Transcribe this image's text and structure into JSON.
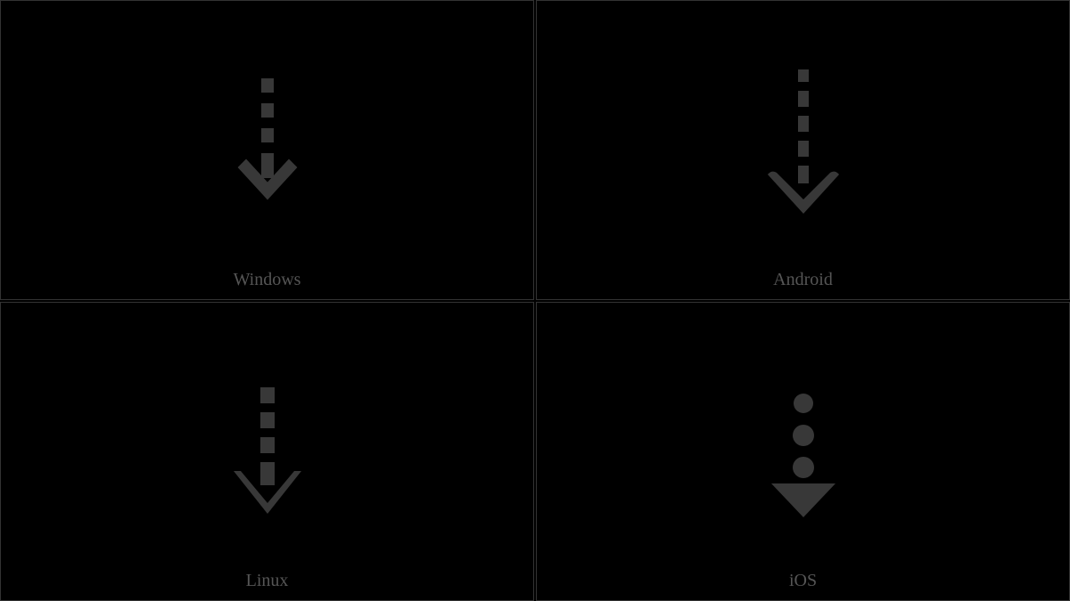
{
  "cells": [
    {
      "label": "Windows",
      "glyph_name": "down-dashed-arrow-windows"
    },
    {
      "label": "Android",
      "glyph_name": "down-dashed-arrow-android"
    },
    {
      "label": "Linux",
      "glyph_name": "down-dashed-arrow-linux"
    },
    {
      "label": "iOS",
      "glyph_name": "down-dashed-arrow-ios"
    }
  ],
  "glyph_color": "#383838"
}
